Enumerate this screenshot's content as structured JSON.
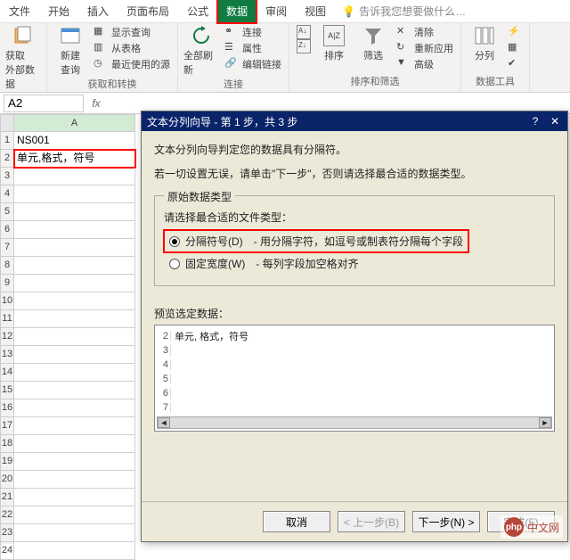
{
  "tabs": {
    "file": "文件",
    "home": "开始",
    "insert": "插入",
    "layout": "页面布局",
    "formulas": "公式",
    "data": "数据",
    "review": "审阅",
    "view": "视图"
  },
  "tellme": "告诉我您想要做什么…",
  "ribbon": {
    "group1": {
      "btn1": "获取\n外部数据",
      "title": ""
    },
    "group2": {
      "btn_new_query": "新建\n查询",
      "sub_show_query": "显示查询",
      "sub_from_table": "从表格",
      "sub_recent": "最近使用的源",
      "title": "获取和转换"
    },
    "group3": {
      "btn_refresh": "全部刷新",
      "sub_conn": "连接",
      "sub_prop": "属性",
      "sub_edit": "编辑链接",
      "title": "连接"
    },
    "group4": {
      "sort_az": "A↓Z",
      "sort_za": "Z↓A",
      "btn_sort": "排序",
      "btn_filter": "筛选",
      "sub_clear": "清除",
      "sub_reapply": "重新应用",
      "sub_advanced": "高级",
      "title": "排序和筛选"
    },
    "group5": {
      "btn_t2c": "分列",
      "title": "数据工具"
    }
  },
  "nameBox": "A2",
  "cells": {
    "A1": "NS001",
    "A2": "单元,格式，符号"
  },
  "colHeaders": {
    "A": "A"
  },
  "dialog": {
    "title": "文本分列向导 - 第 1 步，共 3 步",
    "line1": "文本分列向导判定您的数据具有分隔符。",
    "line2": "若一切设置无误，请单击\"下一步\"，否则请选择最合适的数据类型。",
    "group_label": "原始数据类型",
    "choose_label": "请选择最合适的文件类型：",
    "opt_delim": "分隔符号(D)",
    "opt_delim_desc": "- 用分隔字符，如逗号或制表符分隔每个字段",
    "opt_fixed": "固定宽度(W)",
    "opt_fixed_desc": "- 每列字段加空格对齐",
    "preview_label": "预览选定数据：",
    "preview_text": "单元, 格式，符号",
    "btn_cancel": "取消",
    "btn_back": "< 上一步(B)",
    "btn_next": "下一步(N) >",
    "btn_finish": "完成(F)"
  },
  "watermark": "中文网"
}
